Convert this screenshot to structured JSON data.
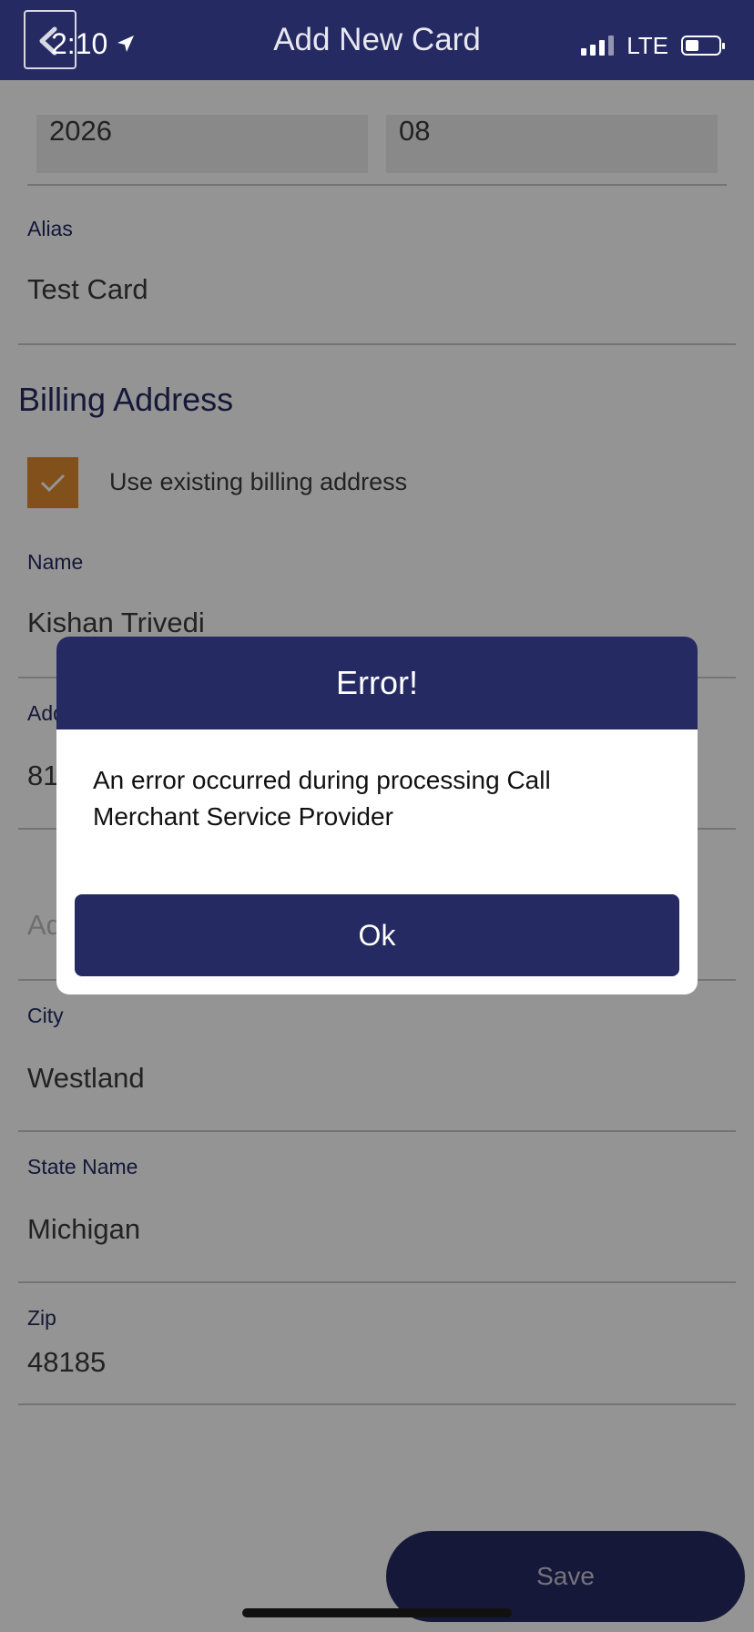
{
  "status_bar": {
    "time": "2:10",
    "network": "LTE"
  },
  "header": {
    "title": "Add New Card"
  },
  "expiry": {
    "year": "2026",
    "month": "08"
  },
  "alias": {
    "label": "Alias",
    "value": "Test Card"
  },
  "billing": {
    "title": "Billing Address",
    "use_existing_label": "Use existing billing address",
    "use_existing_checked": true
  },
  "name": {
    "label": "Name",
    "value": "Kishan Trivedi"
  },
  "address1": {
    "label_visible": "Add",
    "value_visible": "81"
  },
  "address2": {
    "placeholder_visible": "Ad"
  },
  "city": {
    "label": "City",
    "value": "Westland"
  },
  "state": {
    "label": "State Name",
    "value": "Michigan"
  },
  "zip": {
    "label": "Zip",
    "value": "48185"
  },
  "save_button": {
    "label": "Save"
  },
  "dialog": {
    "title": "Error!",
    "message": "An error occurred during processing Call Merchant Service Provider",
    "ok_label": "Ok"
  },
  "colors": {
    "primary": "#252a63",
    "checkbox": "#e08a2f",
    "overlay": "rgba(0,0,0,0.42)"
  }
}
